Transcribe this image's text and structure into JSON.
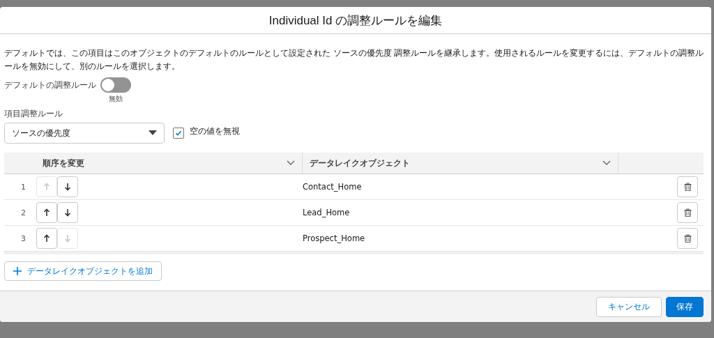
{
  "modal": {
    "title": "Individual Id の調整ルールを編集"
  },
  "description": "デフォルトでは、この項目はこのオブジェクトのデフォルトのルールとして設定された ソースの優先度 調整ルールを継承します。使用されるルールを変更するには、デフォルトの調整ルールを無効にして、別のルールを選択します。",
  "default_rule": {
    "label": "デフォルトの調整ルール",
    "on": false,
    "state_label": "無効"
  },
  "field_rule": {
    "label": "項目調整ルール",
    "value": "ソースの優先度"
  },
  "ignore_empty": {
    "label": "空の値を無視",
    "checked": true
  },
  "table": {
    "columns": [
      "順序を変更",
      "データレイクオブジェクト"
    ],
    "rows": [
      {
        "index": "1",
        "up_disabled": true,
        "down_disabled": false,
        "object": "Contact_Home"
      },
      {
        "index": "2",
        "up_disabled": false,
        "down_disabled": false,
        "object": "Lead_Home"
      },
      {
        "index": "3",
        "up_disabled": false,
        "down_disabled": true,
        "object": "Prospect_Home"
      }
    ]
  },
  "add_button": "データレイクオブジェクトを追加",
  "footer": {
    "buttons": [
      {
        "label": "キャンセル",
        "kind": "neutral"
      },
      {
        "label": "保存",
        "kind": "brand"
      }
    ]
  }
}
